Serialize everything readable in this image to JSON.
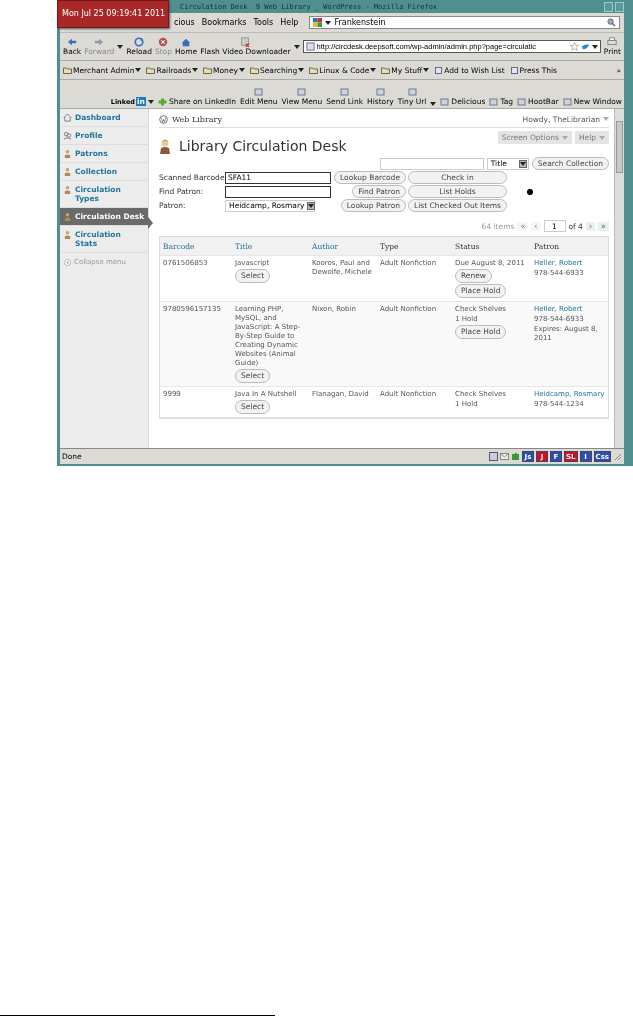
{
  "clock": "Mon Jul 25 09:19:41 2011",
  "window": {
    "title": "Circulation Desk  9 Web Library _ WordPress - Mozilla Firefox"
  },
  "menu": [
    "cious",
    "Bookmarks",
    "Tools",
    "Help"
  ],
  "search_bar": {
    "value": "Frankenstein"
  },
  "nav_buttons": [
    {
      "label": "Back",
      "disabled": false
    },
    {
      "label": "Forward",
      "disabled": true
    },
    {
      "label": "Reload",
      "disabled": false
    },
    {
      "label": "Stop",
      "disabled": true
    },
    {
      "label": "Home",
      "disabled": false
    },
    {
      "label": "Flash Video Downloader",
      "disabled": false
    }
  ],
  "url": "http://circdesk.deepsoft.com/wp-admin/admin.php?page=circulatic",
  "print": "Print",
  "bookmarks": [
    {
      "label": "Merchant Admin",
      "kind": "folder"
    },
    {
      "label": "Railroads",
      "kind": "folder"
    },
    {
      "label": "Money",
      "kind": "folder"
    },
    {
      "label": "Searching",
      "kind": "folder"
    },
    {
      "label": "Linux & Code",
      "kind": "folder"
    },
    {
      "label": "My Stuff",
      "kind": "folder"
    },
    {
      "label": "Add to Wish List",
      "kind": "page"
    },
    {
      "label": "Press This",
      "kind": "page"
    }
  ],
  "bookmarks_more": "»",
  "addon_toolbar": {
    "linkedin": "Linked",
    "linkedin_badge": "in",
    "items": [
      "Share on LinkedIn",
      "Edit Menu",
      "View Menu",
      "Send Link",
      "History",
      "Tiny Url",
      "Delicious",
      "Tag",
      "HootBar",
      "New Window"
    ]
  },
  "sidebar": {
    "items": [
      {
        "label": "Dashboard",
        "selected": false
      },
      {
        "label": "Profile",
        "selected": false
      },
      {
        "label": "Patrons",
        "selected": false
      },
      {
        "label": "Collection",
        "selected": false
      },
      {
        "label": "Circulation Types",
        "selected": false
      },
      {
        "label": "Circulation Desk",
        "selected": true
      },
      {
        "label": "Circulation Stats",
        "selected": false
      }
    ],
    "collapse": "Collapse menu"
  },
  "site_name": "Web Library",
  "howdy": "Howdy, TheLibrarian",
  "screen_options": "Screen Options",
  "help": "Help",
  "page_title": "Library Circulation Desk",
  "search": {
    "field": "Title",
    "button": "Search Collection"
  },
  "form": {
    "barcode_label": "Scanned Barcode",
    "barcode_value": "SFA11",
    "find_label": "Find Patron:",
    "patron_label": "Patron:",
    "patron_value": "Heidcamp, Rosmary",
    "buttons": [
      "Lookup Barcode",
      "Check in",
      "Find Patron",
      "List Holds",
      "Lookup Patron",
      "List Checked Out Items"
    ]
  },
  "pagination": {
    "count": "64 items",
    "first": {
      "label": "«",
      "disabled": true
    },
    "prev": {
      "label": "‹",
      "disabled": true
    },
    "page": "1",
    "of": "of 4",
    "next": {
      "label": "›",
      "disabled": false
    },
    "last": {
      "label": "»",
      "disabled": false
    }
  },
  "table": {
    "columns": [
      {
        "label": "Barcode",
        "link": true
      },
      {
        "label": "Title",
        "link": true
      },
      {
        "label": "Author",
        "link": true
      },
      {
        "label": "Type",
        "link": false
      },
      {
        "label": "Status",
        "link": false
      },
      {
        "label": "Patron",
        "link": false
      }
    ],
    "rows": [
      {
        "barcode": "0761506853",
        "title": "Javascript",
        "select": "Select",
        "author": "Kooros, Paul and Dewolfe, Michele",
        "type": "Adult Nonfiction",
        "status": [
          "Due August 8, 2011"
        ],
        "status_buttons": [
          "Renew",
          "Place Hold"
        ],
        "patron": "Heller, Robert",
        "patron_lines": [
          "978-544-6933"
        ]
      },
      {
        "barcode": "9780596157135",
        "title": "Learning PHP, MySQL, and JavaScript: A Step-By-Step Guide to Creating Dynamic Websites (Animal Guide)",
        "select": "Select",
        "author": "Nixon, Robin",
        "type": "Adult Nonfiction",
        "status": [
          "Check Shelves",
          "1 Hold"
        ],
        "status_buttons": [
          "Place Hold"
        ],
        "patron": "Heller, Robert",
        "patron_lines": [
          "978-544-6933",
          "Expires: August 8, 2011"
        ]
      },
      {
        "barcode": "9999",
        "title": "Java In A Nutshell",
        "select": "Select",
        "author": "Flanagan, David",
        "type": "Adult Nonfiction",
        "status": [
          "Check Shelves",
          "1 Hold"
        ],
        "status_buttons": [],
        "patron": "Heidcamp, Rosmary",
        "patron_lines": [
          "978-544-1234"
        ]
      }
    ]
  },
  "status_bar": {
    "text": "Done",
    "badges": [
      {
        "label": "Js",
        "color": "#2a4fb0"
      },
      {
        "label": "J",
        "color": "#d01020"
      },
      {
        "label": "F",
        "color": "#2a4fb0"
      },
      {
        "label": "SL",
        "color": "#d01020"
      },
      {
        "label": "I",
        "color": "#2a4fb0"
      },
      {
        "label": "Css",
        "color": "#2a4fb0"
      }
    ]
  }
}
